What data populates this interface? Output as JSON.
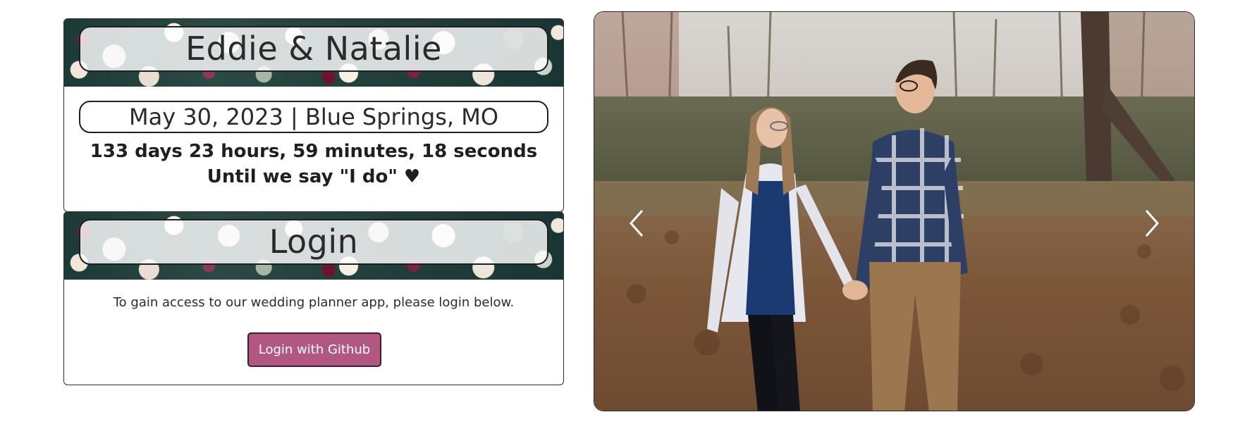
{
  "header": {
    "title": "Eddie & Natalie",
    "date_location": "May 30, 2023 | Blue Springs, MO"
  },
  "countdown": {
    "line1": "133 days 23 hours, 59 minutes, 18 seconds",
    "line2": "Until we say \"I do\" ♥"
  },
  "login": {
    "title": "Login",
    "text": "To gain access to our wedding planner app, please login below.",
    "button_label": "Login with Github"
  },
  "carousel": {
    "icons": {
      "prev": "chevron-left-icon",
      "next": "chevron-right-icon"
    }
  },
  "colors": {
    "button": "#b25682",
    "border": "#2f2f2f"
  }
}
